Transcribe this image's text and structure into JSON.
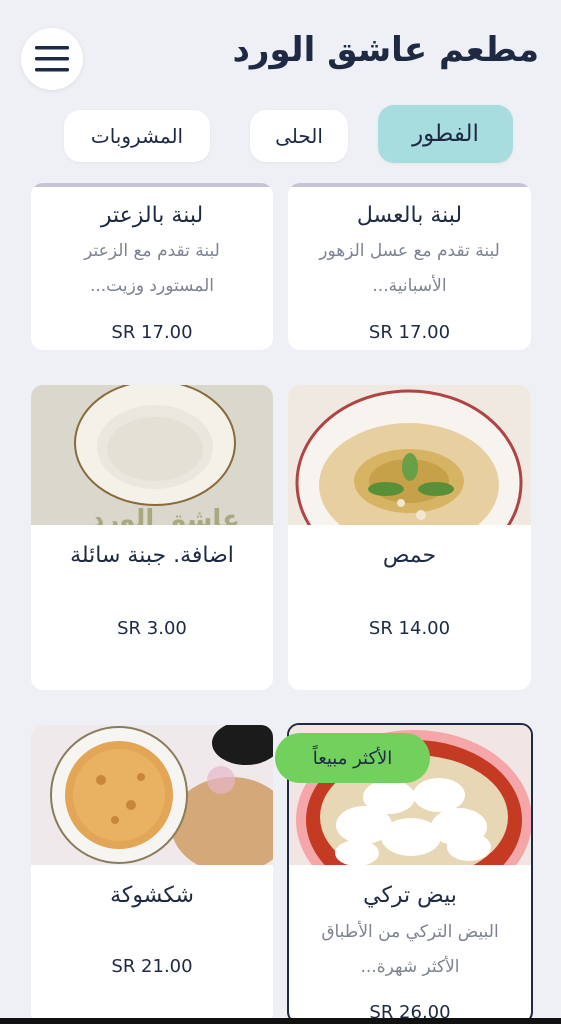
{
  "header": {
    "title": "مطعم عاشق الورد",
    "menu_icon": "hamburger-menu-icon"
  },
  "tabs": [
    {
      "label": "الفطور",
      "active": true
    },
    {
      "label": "الحلى",
      "active": false
    },
    {
      "label": "المشروبات",
      "active": false
    }
  ],
  "items": [
    {
      "name": "لبنة بالعسل",
      "desc_line1": "لبنة تقدم مع عسل الزهور",
      "desc_line2": "الأسبانية...",
      "price": "SR 17.00"
    },
    {
      "name": "لبنة بالزعتر",
      "desc_line1": "لبنة تقدم مع الزعتر",
      "desc_line2": "المستورد وزيت...",
      "price": "SR 17.00"
    },
    {
      "name": "حمص",
      "price": "SR 14.00",
      "image": "hummus-photo"
    },
    {
      "name": "اضافة. جبنة سائلة",
      "price": "SR 3.00",
      "image": "liquid-cheese-photo",
      "image_watermark": "عاشق الورد"
    },
    {
      "name": "بيض تركي",
      "desc_line1": "البيض التركي من الأطباق",
      "desc_line2": "الأكثر شهرة...",
      "price": "SR 26.00",
      "badge": "الأكثر مبيعاً",
      "image": "turkish-eggs-photo"
    },
    {
      "name": "شكشوكة",
      "price": "SR 21.00",
      "image": "shakshuka-photo"
    }
  ],
  "colors": {
    "background": "#eef0f5",
    "active_tab": "#a8dde0",
    "badge": "#72d15d",
    "text": "#1e2a44",
    "muted": "#7d8391"
  }
}
